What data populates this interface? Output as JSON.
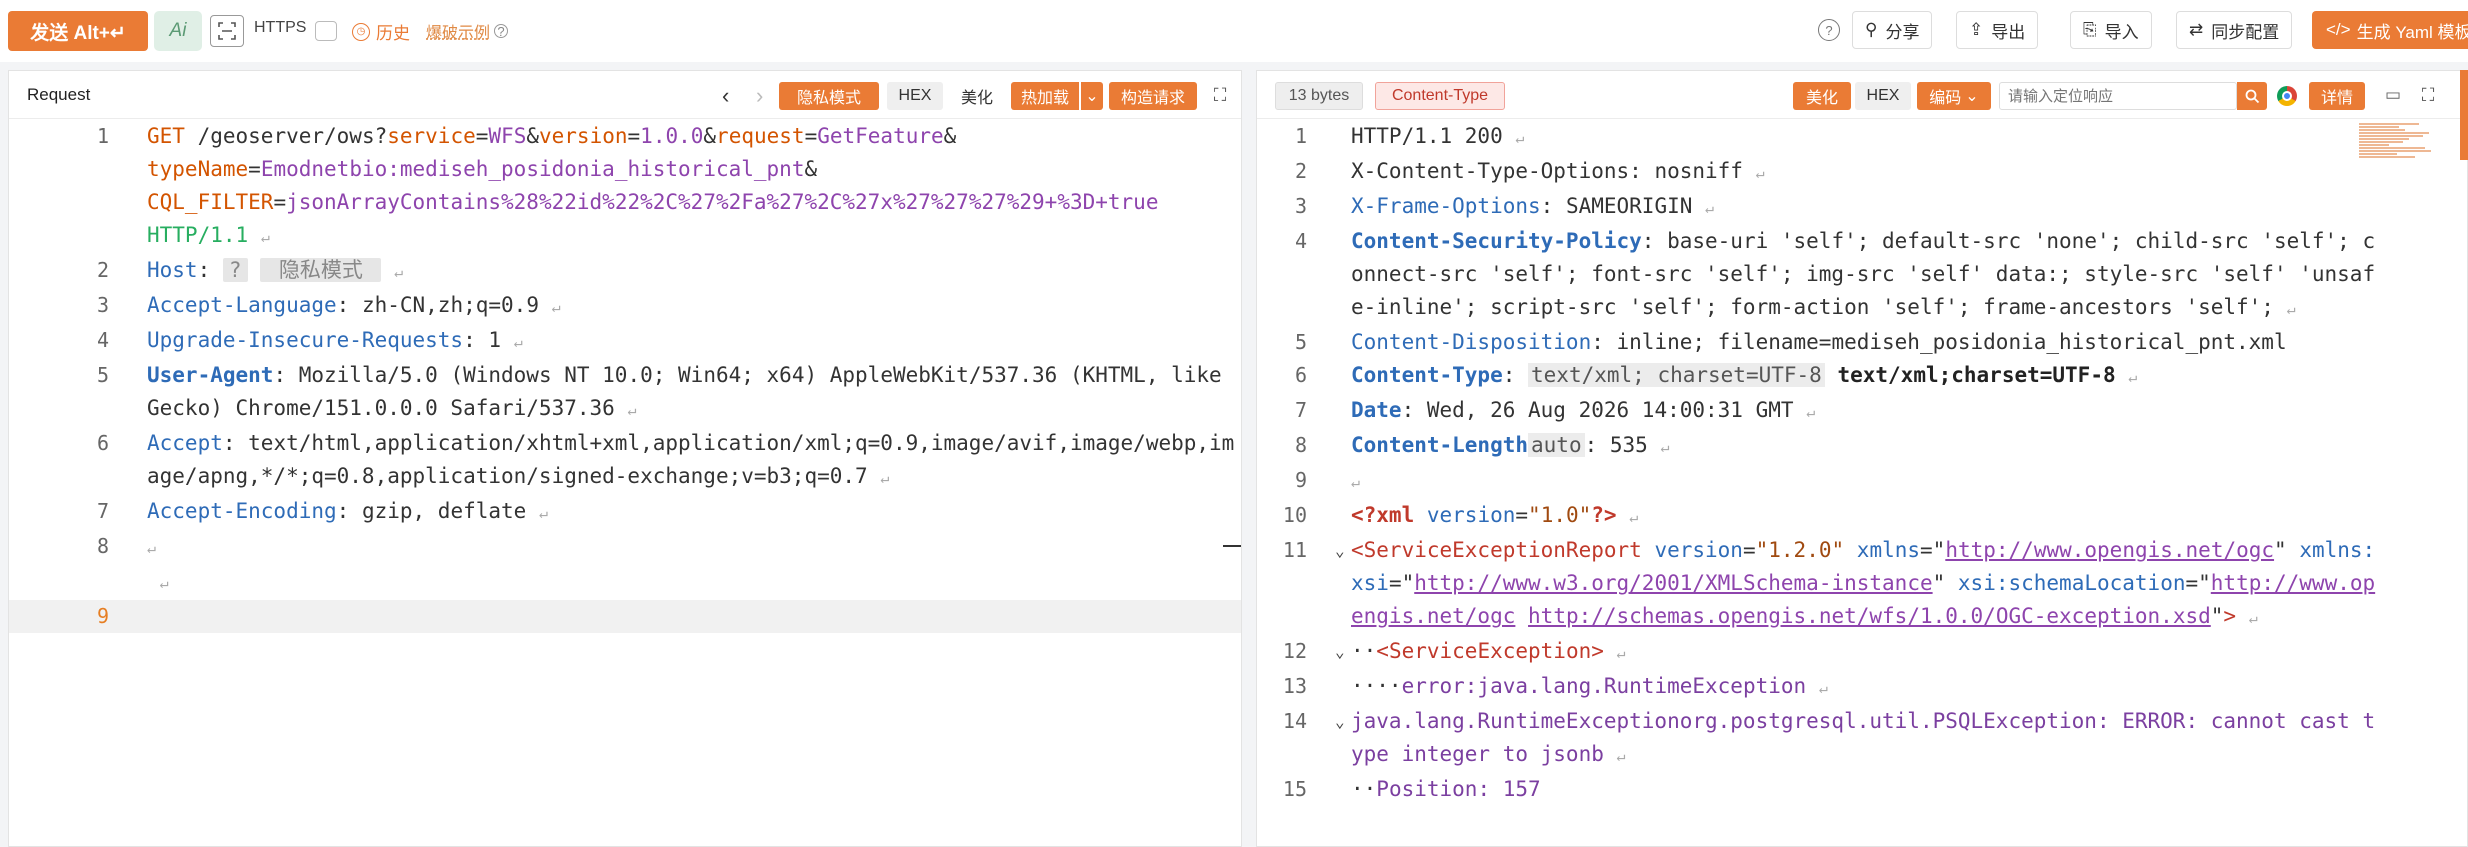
{
  "toolbar": {
    "send_label": "发送 Alt+↵",
    "ai_label": "Ai",
    "https_label": "HTTPS",
    "history_label": "历史",
    "brute_label": "爆破示例",
    "share_label": "分享",
    "export_label": "导出",
    "import_label": "导入",
    "sync_label": "同步配置",
    "yaml_label": "生成 Yaml 模板"
  },
  "request": {
    "title": "Request",
    "btn_private": "隐私模式",
    "btn_hex": "HEX",
    "btn_beautify": "美化",
    "btn_hotload": "热加载",
    "btn_construct": "构造请求",
    "line1_method": "GET",
    "line1_path": " /geoserver/ows?",
    "p_service": "service",
    "v_service": "WFS",
    "p_version": "version",
    "v_version": "1.0.0",
    "p_request": "request",
    "v_request": "GetFeature",
    "p_typename": "typeName",
    "v_typename": "Emodnetbio:mediseh_posidonia_historical_pnt",
    "p_cql": "CQL_FILTER",
    "v_cql": "jsonArrayContains%28%22id%22%2C%27%2Fa%27%2C%27x%27%27%27%29+%3D+true",
    "protocol": "HTTP/1.1",
    "host_key": "Host",
    "host_q": "?",
    "host_private": " 隐私模式 ",
    "al_key": "Accept-Language",
    "al_val": "zh-CN,zh;q=0.9",
    "uir_key": "Upgrade-Insecure-Requests",
    "uir_val": "1",
    "ua_key": "User-Agent",
    "ua_val": "Mozilla/5.0 (Windows NT 10.0; Win64; x64) AppleWebKit/537.36 (KHTML, like Gecko) Chrome/151.0.0.0 Safari/537.36",
    "accept_key": "Accept",
    "accept_val": "text/html,application/xhtml+xml,application/xml;q=0.9,image/avif,image/webp,image/apng,*/*;q=0.8,application/signed-exchange;v=b3;q=0.7",
    "ae_key": "Accept-Encoding",
    "ae_val": "gzip, deflate",
    "line_numbers": [
      "1",
      "2",
      "3",
      "4",
      "5",
      "6",
      "7",
      "8",
      "9"
    ]
  },
  "response": {
    "bytes_badge": "13 bytes",
    "ct_badge": "Content-Type",
    "btn_beautify": "美化",
    "btn_hex": "HEX",
    "btn_encoding": "编码",
    "search_placeholder": "请输入定位响应",
    "btn_detail": "详情",
    "status_line": "HTTP/1.1 200",
    "xcto_key": "X-Content-Type-Options",
    "xcto_val": "nosniff",
    "xfo_key": "X-Frame-Options",
    "xfo_val": "SAMEORIGIN",
    "csp_key": "Content-Security-Policy",
    "csp_val": "base-uri 'self'; default-src 'none'; child-src 'self'; connect-src 'self'; font-src 'self'; img-src 'self' data:; style-src 'self' 'unsafe-inline'; script-src 'self'; form-action 'self'; frame-ancestors 'self';",
    "cd_key": "Content-Disposition",
    "cd_val": "inline; filename=mediseh_posidonia_historical_pnt.xml",
    "ct_key": "Content-Type",
    "ct_val": "text/xml; charset=UTF-8",
    "ct_val_bold": "text/xml;charset=UTF-8",
    "date_key": "Date",
    "date_val": "Wed, 26 Aug 2026 14:00:31 GMT",
    "cl_key": "Content-Length",
    "cl_auto": "auto",
    "cl_val": "535",
    "xml_decl_open": "<?xml",
    "xml_decl_attr": "version",
    "xml_decl_val": "\"1.0\"",
    "xml_decl_close": "?>",
    "ser_tag": "<ServiceExceptionReport",
    "ser_version_attr": "version",
    "ser_version_val": "\"1.2.0\"",
    "ser_xmlns_attr": "xmlns",
    "ser_xmlns_url": "http://www.opengis.net/ogc",
    "ser_xsi_attr": "xmlns:xsi",
    "ser_xsi_url": "http://www.w3.org/2001/XMLSchema-instance",
    "ser_sl_attr": "xsi:schemaLocation",
    "ser_sl_url1": "http://www.opengis.net/ogc",
    "ser_sl_url2": "http://schemas.opengis.net/wfs/1.0.0/OGC-exception.xsd",
    "se_tag": "<ServiceException>",
    "err1": "error:java.lang.RuntimeException",
    "err2": "java.lang.RuntimeExceptionorg.postgresql.util.PSQLException: ERROR: cannot cast type integer to jsonb",
    "pos": "Position: 157",
    "line_numbers": [
      "1",
      "2",
      "3",
      "4",
      "5",
      "6",
      "7",
      "8",
      "9",
      "10",
      "11",
      "12",
      "13",
      "14",
      "15"
    ]
  }
}
